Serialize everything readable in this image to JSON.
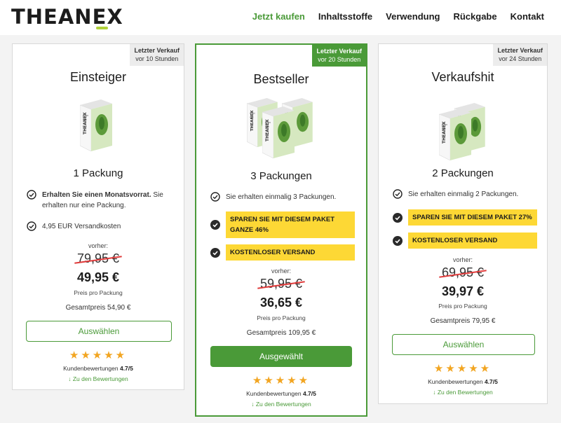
{
  "header": {
    "logo": "THEANEX",
    "nav": [
      "Jetzt kaufen",
      "Inhaltsstoffe",
      "Verwendung",
      "Rückgabe",
      "Kontakt"
    ]
  },
  "colors": {
    "accent": "#4a9a38",
    "highlight": "#fdd835",
    "stars": "#f2a521",
    "strike": "#e03b3b",
    "logo_bar": "#b2d23b"
  },
  "cards": [
    {
      "badge_line1": "Letzter Verkauf",
      "badge_line2": "vor 10 Stunden",
      "title": "Einsteiger",
      "product_image": "box-icon",
      "count": "1 Packung",
      "feature1_bold": "Erhalten Sie einen Monatsvorrat.",
      "feature1_rest": " Sie erhalten nur eine Packung.",
      "feature2": "4,95 EUR Versandkosten",
      "vorher": "vorher:",
      "old_price": "79,95 €",
      "new_price": "49,95 €",
      "per_pack": "Preis pro Packung",
      "total": "Gesamtpreis 54,90 €",
      "button": "Auswählen",
      "stars": "★★★★★",
      "reviews_label": "Kundenbewertungen",
      "reviews_score": "4.7/5",
      "reviews_link": "↓ Zu den Bewertungen"
    },
    {
      "badge_line1": "Letzter Verkauf",
      "badge_line2": "vor 20 Stunden",
      "title": "Bestseller",
      "product_image": "box-icon",
      "count": "3 Packungen",
      "feature1": "Sie erhalten einmalig 3 Packungen.",
      "feature2": "SPAREN SIE MIT DIESEM PAKET GANZE 46%",
      "feature3": "KOSTENLOSER VERSAND",
      "vorher": "vorher:",
      "old_price": "59,95 €",
      "new_price": "36,65 €",
      "per_pack": "Preis pro Packung",
      "total": "Gesamtpreis 109,95 €",
      "button": "Ausgewählt",
      "stars": "★★★★★",
      "reviews_label": "Kundenbewertungen",
      "reviews_score": "4.7/5",
      "reviews_link": "↓ Zu den Bewertungen"
    },
    {
      "badge_line1": "Letzter Verkauf",
      "badge_line2": "vor 24 Stunden",
      "title": "Verkaufshit",
      "product_image": "box-icon",
      "count": "2 Packungen",
      "feature1": "Sie erhalten einmalig 2 Packungen.",
      "feature2": "SPAREN SIE MIT DIESEM PAKET 27%",
      "feature3": "KOSTENLOSER VERSAND",
      "vorher": "vorher:",
      "old_price": "69,95 €",
      "new_price": "39,97 €",
      "per_pack": "Preis pro Packung",
      "total": "Gesamtpreis 79,95 €",
      "button": "Auswählen",
      "stars": "★★★★★",
      "reviews_label": "Kundenbewertungen",
      "reviews_score": "4.7/5",
      "reviews_link": "↓ Zu den Bewertungen"
    }
  ]
}
